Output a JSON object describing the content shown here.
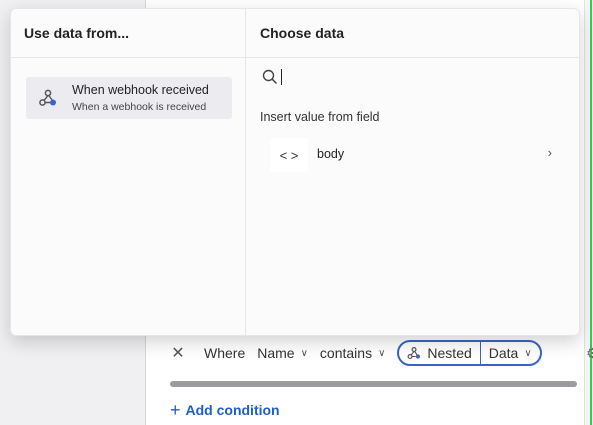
{
  "popup": {
    "left_column_title": "Use data from...",
    "right_column_title": "Choose data",
    "source": {
      "title": "When webhook received",
      "subtitle": "When a webhook is received",
      "icon": "webhook-icon"
    },
    "search": {
      "value": "",
      "placeholder": ""
    },
    "section_label": "Insert value from field",
    "fields": [
      {
        "icon_glyph": "< >",
        "label": "body",
        "icon": "code-icon"
      }
    ]
  },
  "condition": {
    "remove_glyph": "✕",
    "where_label": "Where",
    "field_label": "Name",
    "operator_label": "contains",
    "value_pill": {
      "primary": "Nested",
      "secondary": "Data"
    }
  },
  "add_condition_label": "Add condition",
  "colors": {
    "accent": "#3a64c8",
    "link": "#1f5fc4",
    "edge_highlight": "#32d04a"
  }
}
